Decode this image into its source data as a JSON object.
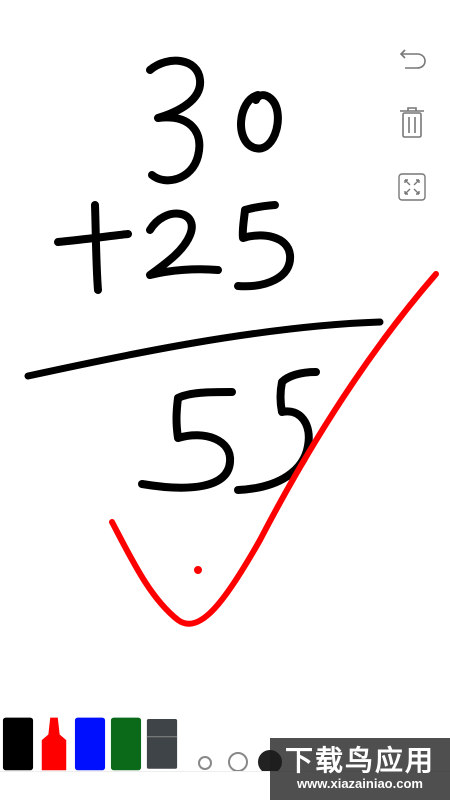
{
  "app": {
    "type": "handwriting-whiteboard"
  },
  "toolbar": {
    "icons": [
      "undo-icon",
      "trash-icon",
      "expand-icon"
    ]
  },
  "palette": {
    "colors": {
      "black": "#000000",
      "red": "#ff0000",
      "blue": "#0010ff",
      "green": "#0a6a1a",
      "gray": "#3e4448"
    },
    "brush_sizes": [
      "small",
      "medium",
      "large"
    ],
    "selected_brush": "large"
  },
  "ink": {
    "black": "#000000",
    "red": "#ff0000"
  },
  "watermark": {
    "logo": "下载鸟应用",
    "url": "www.xiazainiao.com"
  }
}
